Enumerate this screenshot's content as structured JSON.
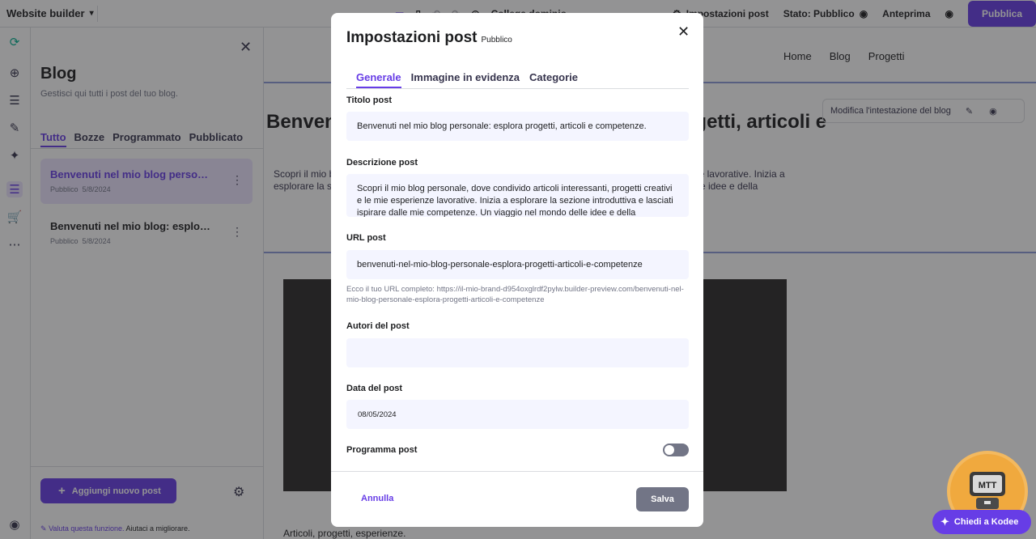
{
  "topbar": {
    "brand": "Website builder",
    "domain": "Collega dominio",
    "post_settings": "Impostazioni post",
    "status": "Stato: Pubblico",
    "preview": "Anteprima",
    "publish": "Pubblica"
  },
  "blog_panel": {
    "title": "Blog",
    "subtitle": "Gestisci qui tutti i post del tuo blog.",
    "tabs": [
      "Tutto",
      "Bozze",
      "Programmato",
      "Pubblicato"
    ],
    "posts": [
      {
        "title": "Benvenuti nel mio blog personale: esplora progetti, articoli e competenze.",
        "status": "Pubblico",
        "date": "5/8/2024"
      },
      {
        "title": "Benvenuti nel mio blog: esplora progetti e competenze",
        "status": "Pubblico",
        "date": "5/8/2024"
      }
    ],
    "add_button": "Aggiungi nuovo post",
    "feedback_link": "Valuta questa funzione.",
    "feedback_text": "Aiutaci a migliorare."
  },
  "canvas": {
    "nav": [
      "Home",
      "Blog",
      "Progetti"
    ],
    "headline": "Benvenuti nel mio blog personale: esplora progetti, articoli e",
    "paragraph": "Scopri il mio blog personale, dove condivido articoli interessanti, progetti creativi e le mie esperienze lavorative. Inizia a esplorare la sezione introduttiva e lasciati ispirare dalle mie competenze. Un viaggio nel mondo delle idee e della",
    "edit_header": "Modifica l'intestazione del blog",
    "bottom_text": "Articoli, progetti, esperienze."
  },
  "modal": {
    "title": "Impostazioni post",
    "badge": "Pubblico",
    "tabs": [
      "Generale",
      "Immagine in evidenza",
      "Categorie"
    ],
    "title_label": "Titolo post",
    "title_value": "Benvenuti nel mio blog personale: esplora progetti, articoli e competenze.",
    "desc_label": "Descrizione post",
    "desc_value": "Scopri il mio blog personale, dove condivido articoli interessanti, progetti creativi e le mie esperienze lavorative. Inizia a esplorare la sezione introduttiva e lasciati ispirare dalle mie competenze. Un viaggio nel mondo delle idee e della",
    "url_label": "URL post",
    "url_value": "benvenuti-nel-mio-blog-personale-esplora-progetti-articoli-e-competenze",
    "url_hint": "Ecco il tuo URL completo: https://il-mio-brand-d954oxglrdf2pylw.builder-preview.com/benvenuti-nel-mio-blog-personale-esplora-progetti-articoli-e-competenze",
    "authors_label": "Autori del post",
    "authors_value": "",
    "date_label": "Data del post",
    "date_value": "08/05/2024",
    "schedule_label": "Programma post",
    "schedule_on": false,
    "cancel": "Annulla",
    "save": "Salva"
  },
  "kodee": {
    "button": "Chiedi a Kodee",
    "avatar_text": "MTT"
  },
  "colors": {
    "accent": "#673de6",
    "accent_light": "#ebe4ff",
    "muted": "#727586",
    "field_bg": "#f4f5ff"
  }
}
